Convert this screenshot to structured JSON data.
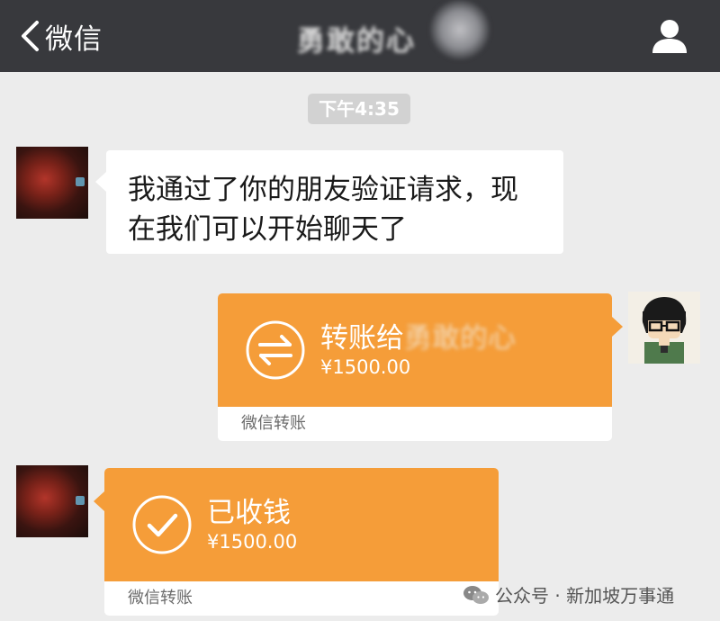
{
  "header": {
    "back_label": "微信",
    "title": "勇敢的心"
  },
  "timestamp": "下午4:35",
  "messages": {
    "friend_text": "我通过了你的朋友验证请求，现在我们可以开始聊天了",
    "transfer": {
      "title_prefix": "转账给",
      "recipient": "勇敢的心",
      "amount": "¥1500.00",
      "footer": "微信转账"
    },
    "received": {
      "title": "已收钱",
      "amount": "¥1500.00",
      "footer": "微信转账"
    }
  },
  "watermark": "公众号 · 新加坡万事通",
  "colors": {
    "topbar": "#38393d",
    "transfer_orange": "#f59d39",
    "background": "#ececec"
  },
  "icons": {
    "back": "chevron-left-icon",
    "profile": "person-icon",
    "transfer": "transfer-arrows-icon",
    "received": "checkmark-circle-icon",
    "watermark": "wechat-logo-icon"
  }
}
